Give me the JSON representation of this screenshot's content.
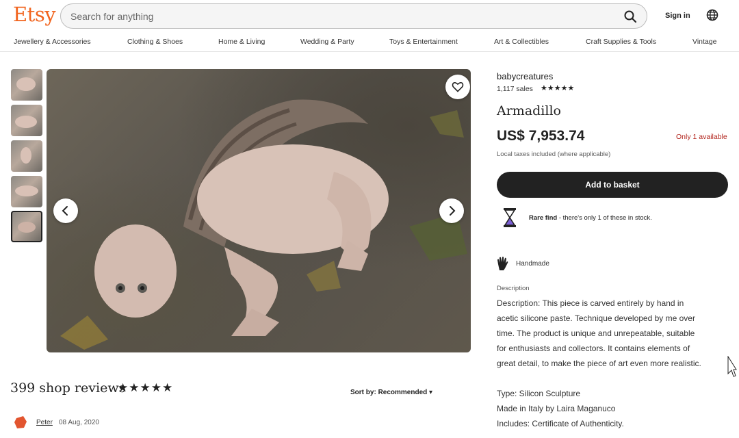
{
  "header": {
    "logo": "Etsy",
    "search_placeholder": "Search for anything",
    "signin_label": "Sign in",
    "nav": [
      "Jewellery & Accessories",
      "Clothing & Shoes",
      "Home & Living",
      "Wedding & Party",
      "Toys & Entertainment",
      "Art & Collectibles",
      "Craft Supplies & Tools",
      "Vintage"
    ]
  },
  "listing": {
    "shop_name": "babycreatures",
    "sales": "1,117 sales",
    "rating_stars": "★★★★★",
    "title": "Armadillo",
    "price": "US$ 7,953.74",
    "availability": "Only 1 available",
    "taxes_note": "Local taxes included (where applicable)",
    "basket_label": "Add to basket",
    "rare_bold": "Rare find",
    "rare_rest": " - there's only 1 of these in stock.",
    "handmade": "Handmade",
    "description_heading": "Description",
    "description_lines": [
      "Description: This piece is carved entirely by hand in",
      "acetic silicone paste. Technique developed by me over",
      "time. The product is unique and unrepeatable, suitable",
      "for enthusiasts and collectors. It contains elements of",
      "great detail, to make the piece of art even more realistic."
    ],
    "specs": [
      "Type: Silicon Sculpture",
      "Made in Italy by Laira Maganuco",
      "Includes: Certificate of Authenticity."
    ]
  },
  "reviews": {
    "count_label": "399 shop reviews",
    "stars": "★★★★★",
    "sort_prefix": "Sort by: ",
    "sort_value": "Recommended",
    "first_reviewer": "Peter",
    "first_date": "08 Aug, 2020"
  },
  "colors": {
    "brand": "#f1641e",
    "button": "#222222",
    "availability": "#b3261e"
  }
}
